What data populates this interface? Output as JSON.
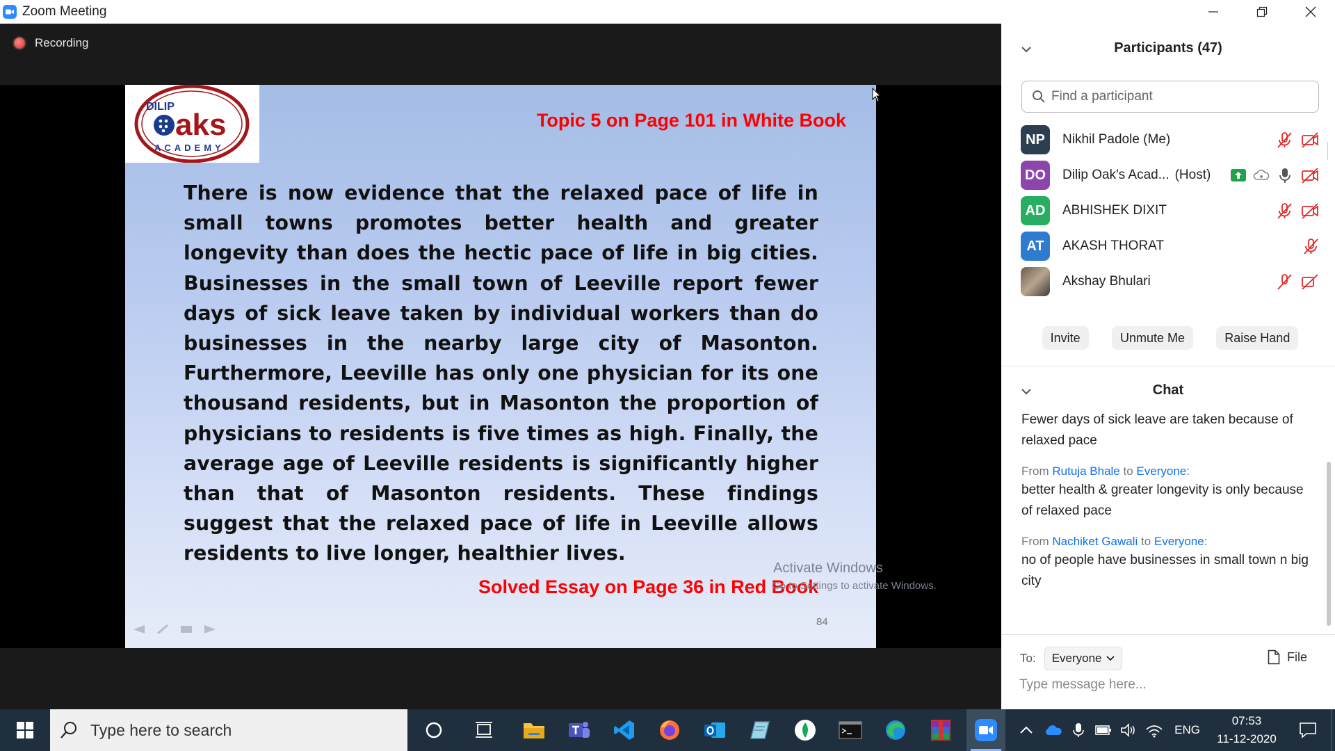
{
  "window": {
    "title": "Zoom Meeting"
  },
  "recording": {
    "label": "Recording"
  },
  "slide": {
    "logo_top": "DILIP",
    "logo_main": "aks",
    "logo_bottom": "ACADEMY",
    "topic": "Topic 5 on Page 101 in White Book",
    "body": "There is now evidence that the relaxed pace of life in small towns promotes better health and greater longevity than does the hectic pace of life in big cities. Businesses in the small town of Leeville report fewer days of sick leave taken by individual workers than do businesses in the nearby large city of Masonton. Furthermore, Leeville has only one physician for its one thousand residents, but in Masonton the proportion of physicians to residents is five times as high. Finally, the average age of Leeville residents is significantly higher than that of Masonton residents. These findings suggest that the relaxed pace of life in Leeville allows residents to live longer, healthier lives.",
    "solved": "Solved Essay on Page 36 in Red Book",
    "page_number": "84"
  },
  "watermark": {
    "line1": "Activate Windows",
    "line2": "Go to Settings to activate Windows."
  },
  "participants": {
    "title": "Participants (47)",
    "search_placeholder": "Find a participant",
    "items": [
      {
        "initials": "NP",
        "name": "Nikhil Padole (Me)",
        "color": "#2d3e50"
      },
      {
        "initials": "DO",
        "name": "Dilip Oak's Acad...",
        "role": "(Host)",
        "color": "#8e44ad"
      },
      {
        "initials": "AD",
        "name": "ABHISHEK DIXIT",
        "color": "#27ae60"
      },
      {
        "initials": "AT",
        "name": "AKASH THORAT",
        "color": "#2e7bcf"
      },
      {
        "initials": "",
        "name": "Akshay Bhulari",
        "color": "#888888"
      }
    ],
    "buttons": {
      "invite": "Invite",
      "unmute": "Unmute Me",
      "raise_hand": "Raise Hand"
    }
  },
  "chat": {
    "title": "Chat",
    "from_label": "From",
    "to_label": "to",
    "messages": [
      {
        "from": "",
        "to": "",
        "text": "Fewer days of sick leave are taken because of relaxed pace"
      },
      {
        "from": "Rutuja Bhale",
        "to": "Everyone:",
        "text": "better health & greater longevity is only because of relaxed pace"
      },
      {
        "from": "Nachiket Gawali",
        "to": "Everyone:",
        "text": "no of people have businesses in small town n big city"
      }
    ],
    "to_field": "To:",
    "recipient": "Everyone",
    "file_label": "File",
    "input_placeholder": "Type message here..."
  },
  "taskbar": {
    "search_placeholder": "Type here to search",
    "lang": "ENG",
    "time": "07:53",
    "date": "11-12-2020"
  }
}
